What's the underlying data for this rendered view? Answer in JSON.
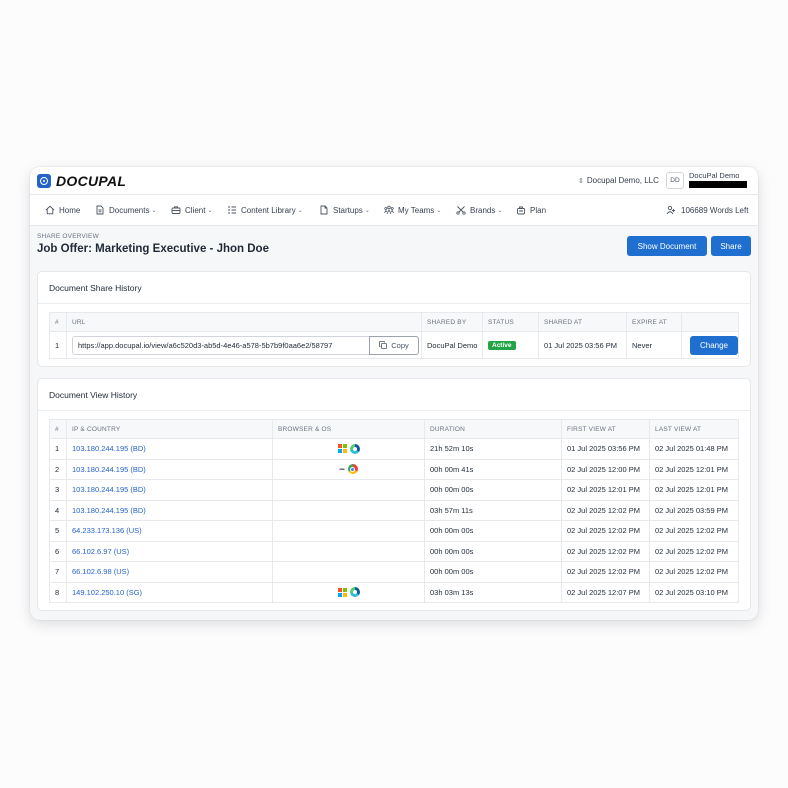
{
  "app": {
    "logo_text": "DOCUPAL"
  },
  "header": {
    "org": "Docupal Demo, LLC",
    "avatar_initials": "DD",
    "user_name": "DocuPal Demo"
  },
  "nav": {
    "items": [
      {
        "label": "Home",
        "icon": "home-icon",
        "dropdown": false
      },
      {
        "label": "Documents",
        "icon": "document-icon",
        "dropdown": true
      },
      {
        "label": "Client",
        "icon": "briefcase-icon",
        "dropdown": true
      },
      {
        "label": "Content Library",
        "icon": "library-icon",
        "dropdown": true
      },
      {
        "label": "Startups",
        "icon": "file-icon",
        "dropdown": true
      },
      {
        "label": "My Teams",
        "icon": "team-icon",
        "dropdown": true
      },
      {
        "label": "Brands",
        "icon": "brands-icon",
        "dropdown": true
      },
      {
        "label": "Plan",
        "icon": "plan-icon",
        "dropdown": false
      }
    ],
    "words_left": "106689 Words Left"
  },
  "page": {
    "overline": "SHARE OVERVIEW",
    "title": "Job Offer: Marketing Executive - Jhon Doe",
    "show_document_label": "Show Document",
    "share_label": "Share"
  },
  "share_history": {
    "title": "Document Share History",
    "columns": [
      "#",
      "URL",
      "SHARED BY",
      "STATUS",
      "SHARED AT",
      "EXPIRE AT",
      ""
    ],
    "rows": [
      {
        "num": "1",
        "url": "https://app.docupal.io/view/a6c520d3-ab5d-4e46-a578-5b7b9f0aa6e2/58797",
        "copy_label": "Copy",
        "shared_by": "DocuPal Demo",
        "status": "Active",
        "shared_at": "01 Jul 2025 03:56 PM",
        "expire_at": "Never",
        "action_label": "Change"
      }
    ]
  },
  "view_history": {
    "title": "Document View History",
    "columns": [
      "#",
      "IP & COUNTRY",
      "BROWSER & OS",
      "DURATION",
      "FIRST VIEW AT",
      "LAST VIEW AT"
    ],
    "rows": [
      {
        "num": "1",
        "ip": "103.180.244.195 (BD)",
        "os_icon": "windows-icon",
        "browser_icon": "edge-icon",
        "duration": "21h 52m 10s",
        "first_view": "01 Jul 2025 03:56 PM",
        "last_view": "02 Jul 2025 01:48 PM"
      },
      {
        "num": "2",
        "ip": "103.180.244.195 (BD)",
        "os_icon": "macos-icon",
        "browser_icon": "chrome-icon",
        "duration": "00h 00m 41s",
        "first_view": "02 Jul 2025 12:00 PM",
        "last_view": "02 Jul 2025 12:01 PM"
      },
      {
        "num": "3",
        "ip": "103.180.244.195 (BD)",
        "os_icon": "",
        "browser_icon": "",
        "duration": "00h 00m 00s",
        "first_view": "02 Jul 2025 12:01 PM",
        "last_view": "02 Jul 2025 12:01 PM"
      },
      {
        "num": "4",
        "ip": "103.180.244.195 (BD)",
        "os_icon": "",
        "browser_icon": "",
        "duration": "03h 57m 11s",
        "first_view": "02 Jul 2025 12:02 PM",
        "last_view": "02 Jul 2025 03:59 PM"
      },
      {
        "num": "5",
        "ip": "64.233.173.136 (US)",
        "os_icon": "",
        "browser_icon": "",
        "duration": "00h 00m 00s",
        "first_view": "02 Jul 2025 12:02 PM",
        "last_view": "02 Jul 2025 12:02 PM"
      },
      {
        "num": "6",
        "ip": "66.102.6.97 (US)",
        "os_icon": "",
        "browser_icon": "",
        "duration": "00h 00m 00s",
        "first_view": "02 Jul 2025 12:02 PM",
        "last_view": "02 Jul 2025 12:02 PM"
      },
      {
        "num": "7",
        "ip": "66.102.6.98 (US)",
        "os_icon": "",
        "browser_icon": "",
        "duration": "00h 00m 00s",
        "first_view": "02 Jul 2025 12:02 PM",
        "last_view": "02 Jul 2025 12:02 PM"
      },
      {
        "num": "8",
        "ip": "149.102.250.10 (SG)",
        "os_icon": "windows-icon",
        "browser_icon": "edge-icon",
        "duration": "03h 03m 13s",
        "first_view": "02 Jul 2025 12:07 PM",
        "last_view": "02 Jul 2025 03:10 PM"
      }
    ]
  },
  "colors": {
    "primary": "#1f6fd1",
    "link": "#2563c9",
    "active_badge": "#22a447"
  }
}
